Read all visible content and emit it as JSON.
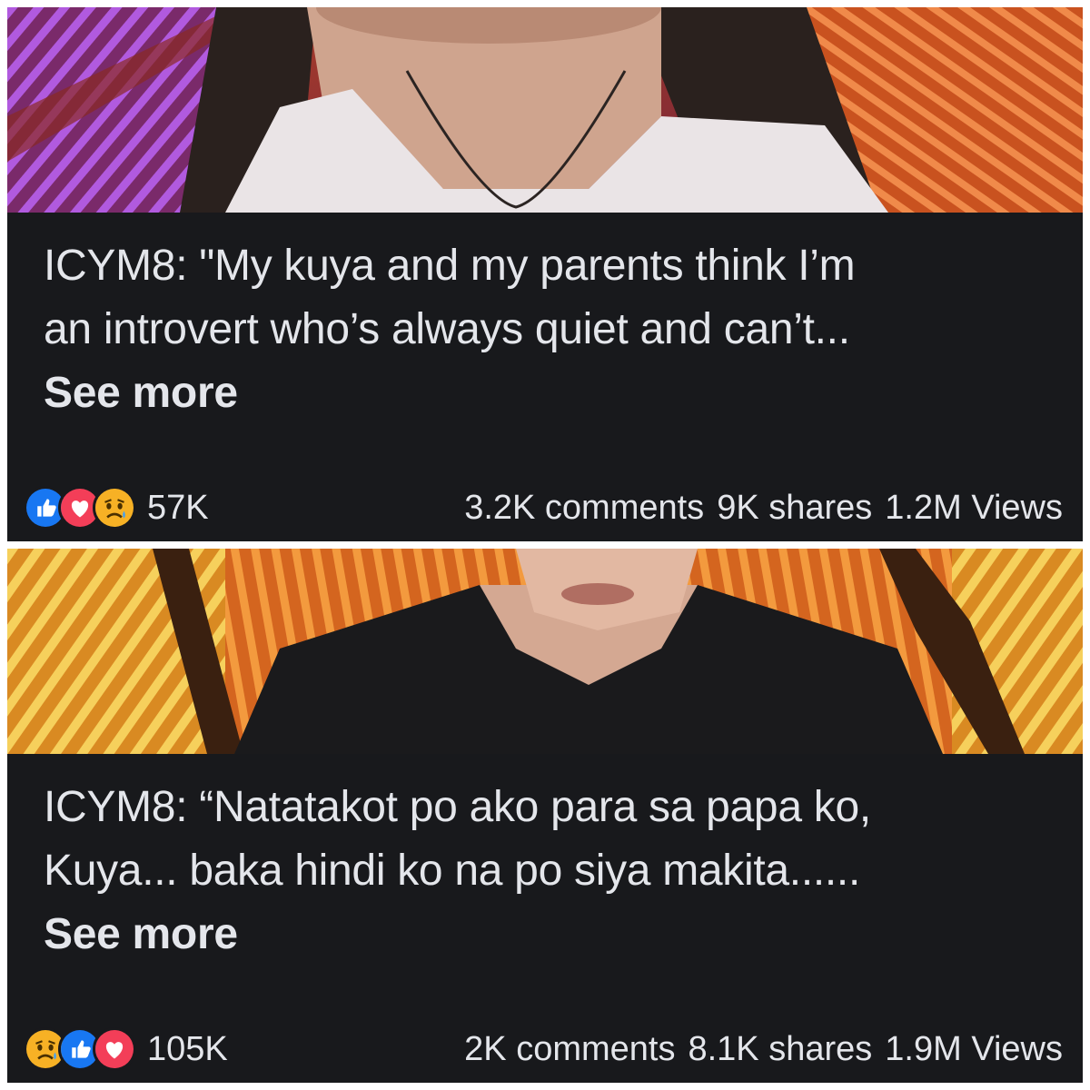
{
  "posts": [
    {
      "caption_line1": "ICYM8: \"My kuya and my parents think I’m",
      "caption_line2": "an introvert who’s always quiet and can’t...",
      "see_more": "See more",
      "reactions": [
        "like-icon",
        "love-icon",
        "sad-icon"
      ],
      "reaction_count": "57K",
      "comments": "3.2K comments",
      "shares": "9K shares",
      "views": "1.2M Views"
    },
    {
      "caption_line1": "ICYM8: “Natatakot po ako para sa papa ko,",
      "caption_line2": "Kuya... baka hindi ko na po siya makita......",
      "see_more": "See more",
      "reactions": [
        "sad-icon",
        "like-icon",
        "love-icon"
      ],
      "reaction_count": "105K",
      "comments": "2K comments",
      "shares": "8.1K shares",
      "views": "1.9M Views"
    }
  ],
  "colors": {
    "background": "#18191c",
    "text": "#e4e6eb",
    "like_blue": "#1877f2",
    "love_red": "#f33e58",
    "sad_yellow": "#f7b125"
  }
}
